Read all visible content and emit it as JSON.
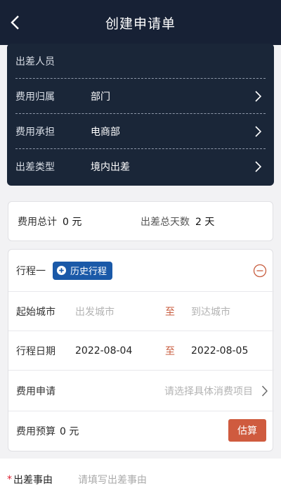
{
  "header": {
    "title": "创建申请单",
    "back_icon": "chevron-left-icon"
  },
  "applicant": {
    "rows": [
      {
        "label": "出差人员",
        "value": ""
      },
      {
        "label": "费用归属",
        "value": "部门"
      },
      {
        "label": "费用承担",
        "value": "电商部"
      },
      {
        "label": "出差类型",
        "value": "境内出差"
      }
    ]
  },
  "summary": {
    "cost_label": "费用总计",
    "cost_value": "0 元",
    "days_label": "出差总天数",
    "days_value": "2 天"
  },
  "trip": {
    "title": "行程一",
    "history_button": "历史行程",
    "city_label": "起始城市",
    "from_placeholder": "出发城市",
    "to_word": "至",
    "to_placeholder": "到达城市",
    "date_label": "行程日期",
    "start_date": "2022-08-04",
    "end_date": "2022-08-05",
    "expense_label": "费用申请",
    "expense_placeholder": "请选择具体消费项目",
    "budget_label": "费用预算",
    "budget_value": "0 元",
    "estimate_button": "估算"
  },
  "reason": {
    "required_mark": "*",
    "label": "出差事由",
    "placeholder": "请填写出差事由"
  },
  "colors": {
    "header_bg": "#172135",
    "card_bg": "#1a2638",
    "accent_blue": "#1a59a8",
    "accent_red": "#cf5b3f"
  }
}
